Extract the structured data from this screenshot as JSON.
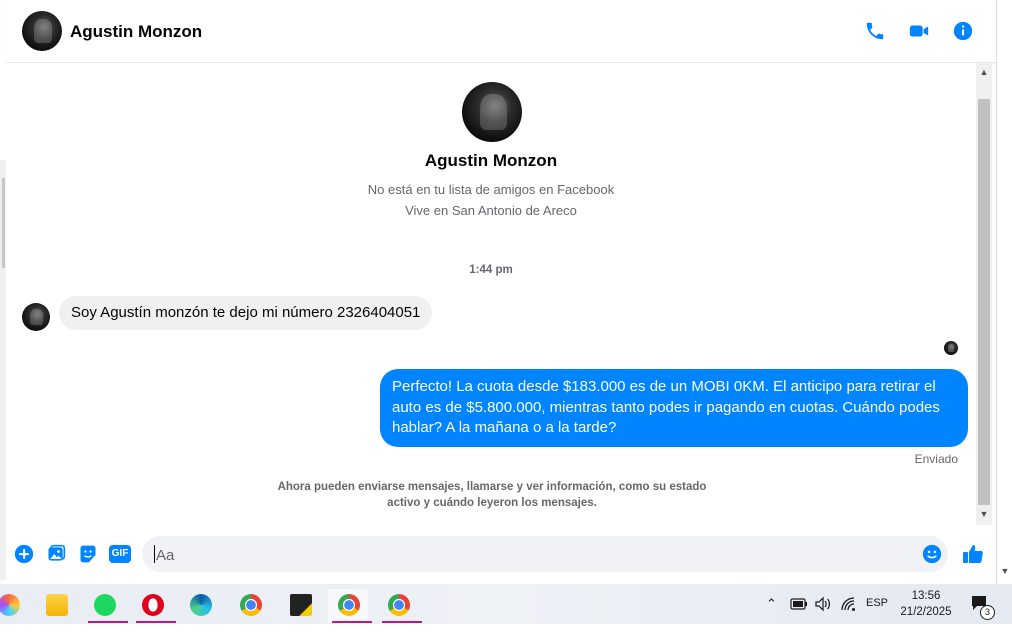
{
  "header": {
    "name": "Agustin Monzon"
  },
  "profile": {
    "name": "Agustin Monzon",
    "friend_status": "No está en tu lista de amigos en Facebook",
    "location": "Vive en San Antonio de Areco"
  },
  "conversation": {
    "timestamp": "1:44 pm",
    "incoming_message": "Soy Agustín monzón te dejo mi número 2326404051",
    "outgoing_message": "Perfecto! La cuota desde $183.000 es de un MOBI 0KM. El anticipo para retirar el auto es de $5.800.000, mientras tanto podes ir pagando en cuotas. Cuándo podes hablar? A la mañana o a la tarde?",
    "sent_status": "Enviado",
    "notice": "Ahora pueden enviarse mensajes, llamarse y ver información, como su estado activo y cuándo leyeron los mensajes."
  },
  "composer": {
    "placeholder": "Aa",
    "gif_label": "GIF"
  },
  "taskbar": {
    "language": "ESP",
    "time": "13:56",
    "date": "21/2/2025",
    "notification_count": "3",
    "apps": [
      "copilot-icon",
      "file-explorer-icon",
      "spotify-icon",
      "opera-icon",
      "edge-icon",
      "chrome-icon",
      "sticky-notes-icon",
      "chrome-profile-icon",
      "chrome-profile-2-icon"
    ]
  },
  "colors": {
    "accent": "#0084ff",
    "bubble_in": "#f0f0f0",
    "muted": "#65676b"
  }
}
